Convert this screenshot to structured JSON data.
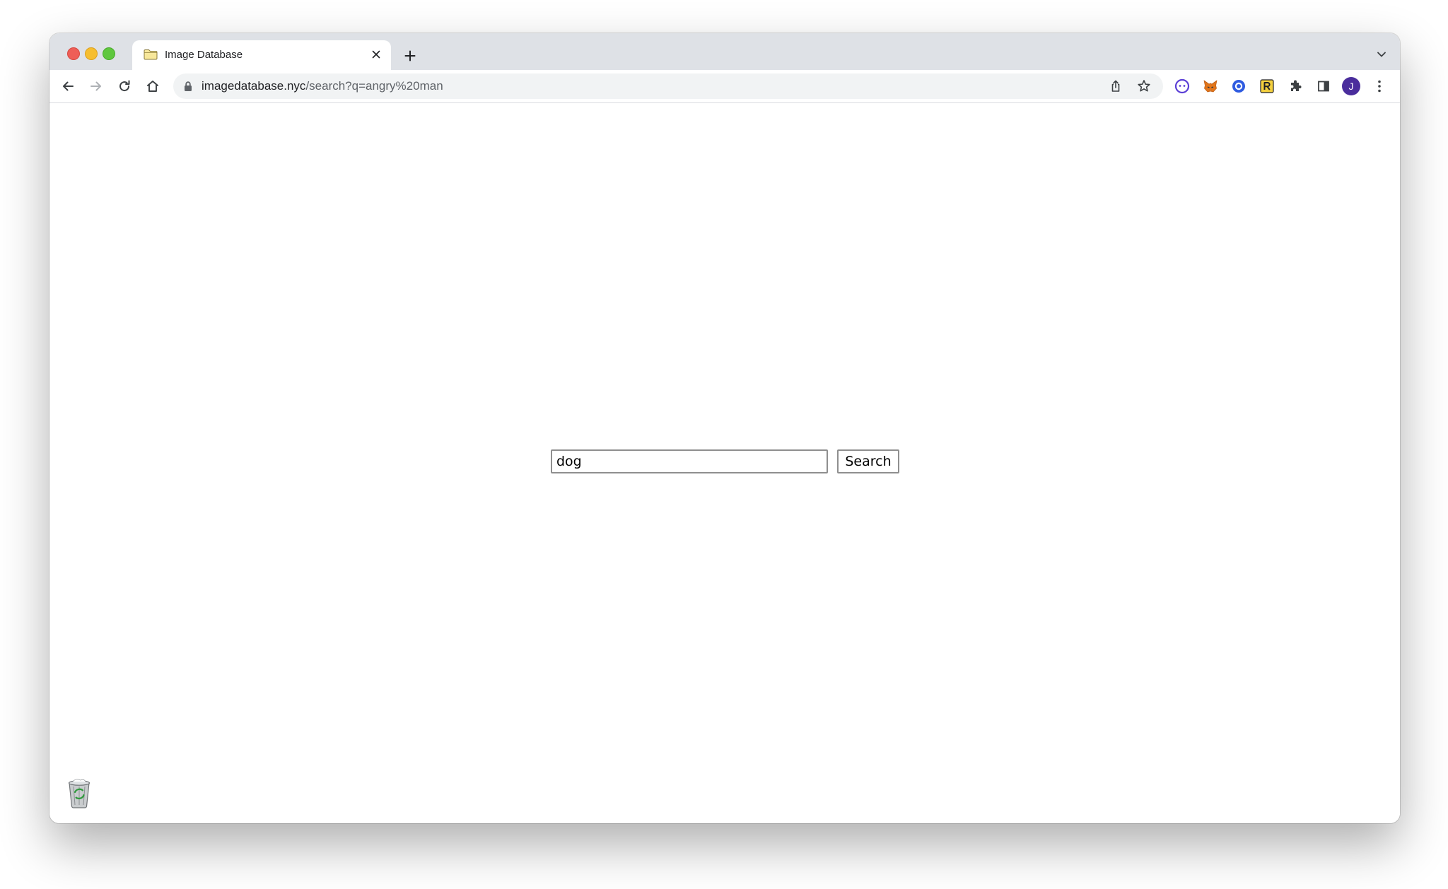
{
  "browser": {
    "tab": {
      "title": "Image Database",
      "favicon": "folder-icon"
    },
    "address_bar": {
      "host": "imagedatabase.nyc",
      "path": "/search?q=angry%20man"
    },
    "profile_initial": "J",
    "icons": {
      "back": "back-arrow-icon",
      "forward": "forward-arrow-icon",
      "reload": "reload-icon",
      "home": "home-icon",
      "share": "share-icon",
      "bookmark": "star-icon",
      "extensions": [
        "chat-extension-icon",
        "metamask-fox-icon",
        "target-extension-icon",
        "r-extension-icon",
        "puzzle-icon",
        "side-panel-icon"
      ],
      "menu": "kebab-menu-icon"
    },
    "colors": {
      "tabbar": "#dee1e6",
      "omnibox": "#f1f3f4",
      "avatar": "#4a2d9c"
    }
  },
  "page": {
    "search": {
      "value": "dog",
      "button_label": "Search"
    }
  },
  "desktop": {
    "trash_icon": "trash-icon"
  }
}
